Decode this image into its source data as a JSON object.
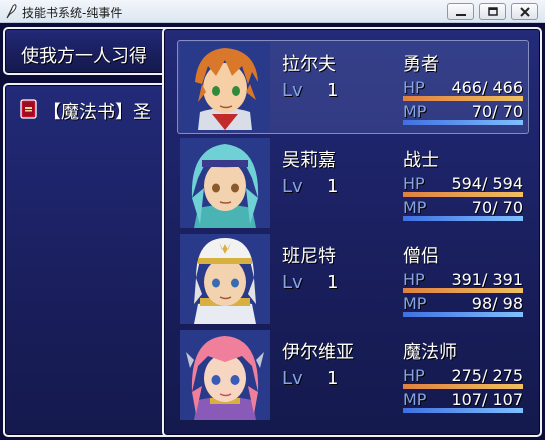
{
  "window": {
    "title": "技能书系统-纯事件",
    "icon": "feather-icon"
  },
  "help": {
    "text": "使我方一人习得"
  },
  "items": [
    {
      "icon": "spellbook-icon",
      "name": "【魔法书】圣"
    }
  ],
  "actors": [
    {
      "name": "拉尔夫",
      "class": "勇者",
      "lv_label": "Lv",
      "level": "1",
      "hp_label": "HP",
      "hp": "466/ 466",
      "hp_ratio": 1.0,
      "mp_label": "MP",
      "mp": "70/  70",
      "mp_ratio": 1.0,
      "selected": true
    },
    {
      "name": "吴莉嘉",
      "class": "战士",
      "lv_label": "Lv",
      "level": "1",
      "hp_label": "HP",
      "hp": "594/ 594",
      "hp_ratio": 1.0,
      "mp_label": "MP",
      "mp": "70/  70",
      "mp_ratio": 1.0,
      "selected": false
    },
    {
      "name": "班尼特",
      "class": "僧侣",
      "lv_label": "Lv",
      "level": "1",
      "hp_label": "HP",
      "hp": "391/ 391",
      "hp_ratio": 1.0,
      "mp_label": "MP",
      "mp": "98/  98",
      "mp_ratio": 1.0,
      "selected": false
    },
    {
      "name": "伊尔维亚",
      "class": "魔法师",
      "lv_label": "Lv",
      "level": "1",
      "hp_label": "HP",
      "hp": "275/ 275",
      "hp_ratio": 1.0,
      "mp_label": "MP",
      "mp": "107/ 107",
      "mp_ratio": 1.0,
      "selected": false
    }
  ],
  "colors": {
    "hp_gauge": [
      "#e08040",
      "#f0c060"
    ],
    "mp_gauge": [
      "#4070e0",
      "#80c0ff"
    ],
    "system_text": "#84a4e6"
  }
}
